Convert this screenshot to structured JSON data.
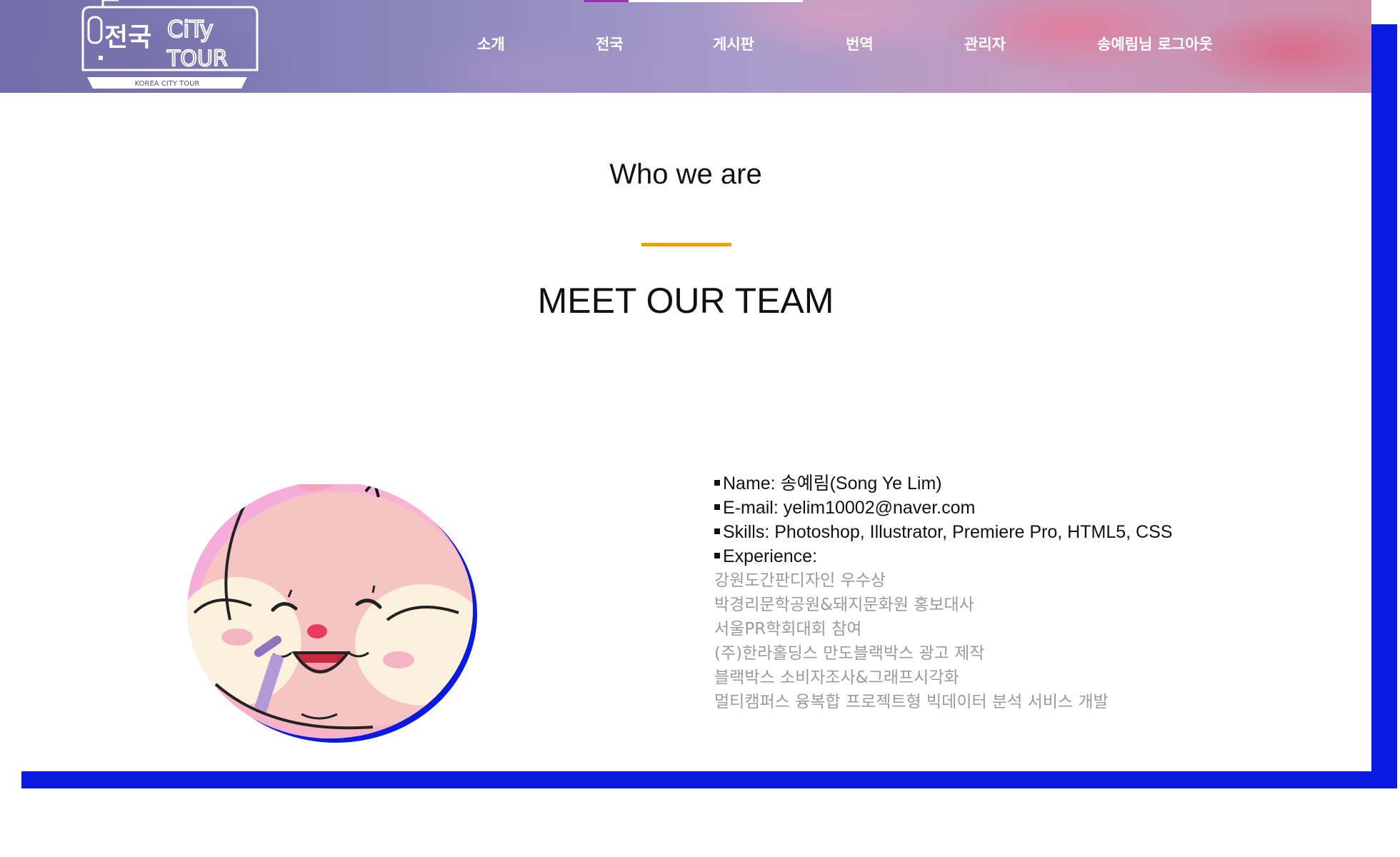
{
  "header": {
    "logo": {
      "korean_text": "전국",
      "english_text_1": "CiTy",
      "english_text_2": "TOUR",
      "caption": "KOREA CITY TOUR"
    },
    "nav": [
      {
        "label": "소개"
      },
      {
        "label": "전국"
      },
      {
        "label": "게시판"
      },
      {
        "label": "번역"
      },
      {
        "label": "관리자"
      },
      {
        "label": "송예림님 로그아웃"
      }
    ]
  },
  "section": {
    "subtitle": "Who we are",
    "title": "MEET OUR TEAM"
  },
  "member": {
    "name_label": "Name:",
    "name_value": "송예림(Song Ye Lim)",
    "email_label": "E-mail:",
    "email_value": "yelim10002@naver.com",
    "skills_label": "Skills:",
    "skills_value": "Photoshop, Illustrator, Premiere Pro, HTML5, CSS",
    "experience_label": "Experience:",
    "experience": [
      "강원도간판디자인 우수상",
      "박경리문학공원&돼지문화원 홍보대사",
      "서울PR학회대회 참여",
      "(주)한라홀딩스 만도블랙박스 광고 제작",
      "블랙박스 소비자조사&그래프시각화",
      "멀티캠퍼스 융복합 프로젝트형 빅데이터 분석 서비스 개발"
    ]
  },
  "colors": {
    "accent_line": "#f0a000",
    "frame_blue": "#0a1be0",
    "muted_text": "#9a9a9a",
    "top_strip_purple": "#9b2fb0",
    "top_strip_white": "#ffffff"
  }
}
